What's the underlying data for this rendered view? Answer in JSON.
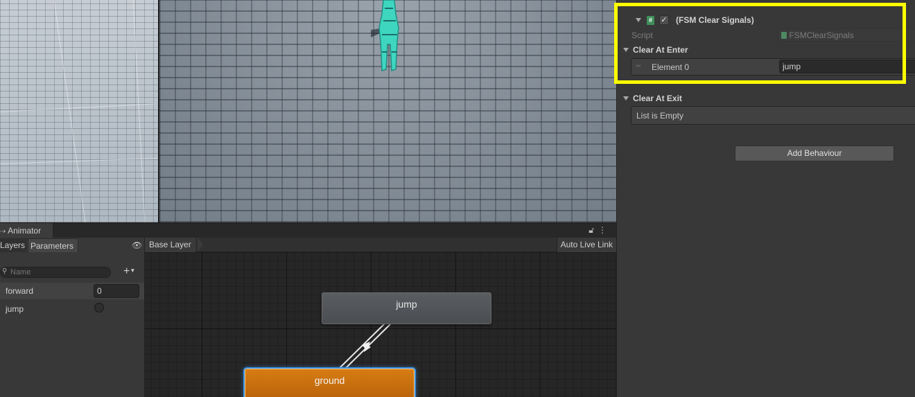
{
  "inspector": {
    "component": {
      "title": "(FSM Clear Signals)",
      "enabled": true,
      "script_label": "Script",
      "script_value": "FSMClearSignals"
    },
    "clear_at_enter": {
      "label": "Clear At Enter",
      "elements": [
        {
          "label": "Element 0",
          "value": "jump"
        }
      ]
    },
    "clear_at_exit": {
      "label": "Clear At Exit",
      "empty_text": "List is Empty"
    },
    "add_behaviour": "Add Behaviour",
    "highlight_color": "#ffff00"
  },
  "animator": {
    "tab_title": "Animator",
    "tabs": {
      "layers": "Layers",
      "parameters": "Parameters"
    },
    "search_placeholder": "Name",
    "parameters": [
      {
        "name": "forward",
        "value": "0"
      },
      {
        "name": "jump",
        "type": "trigger"
      }
    ],
    "breadcrumb": "Base Layer",
    "live_link": "Auto Live Link",
    "states": {
      "jump": "jump",
      "ground": "ground"
    },
    "colors": {
      "default_state": "#52565a",
      "active_state": "#c96e0e",
      "selection": "#3a8fe0"
    }
  }
}
